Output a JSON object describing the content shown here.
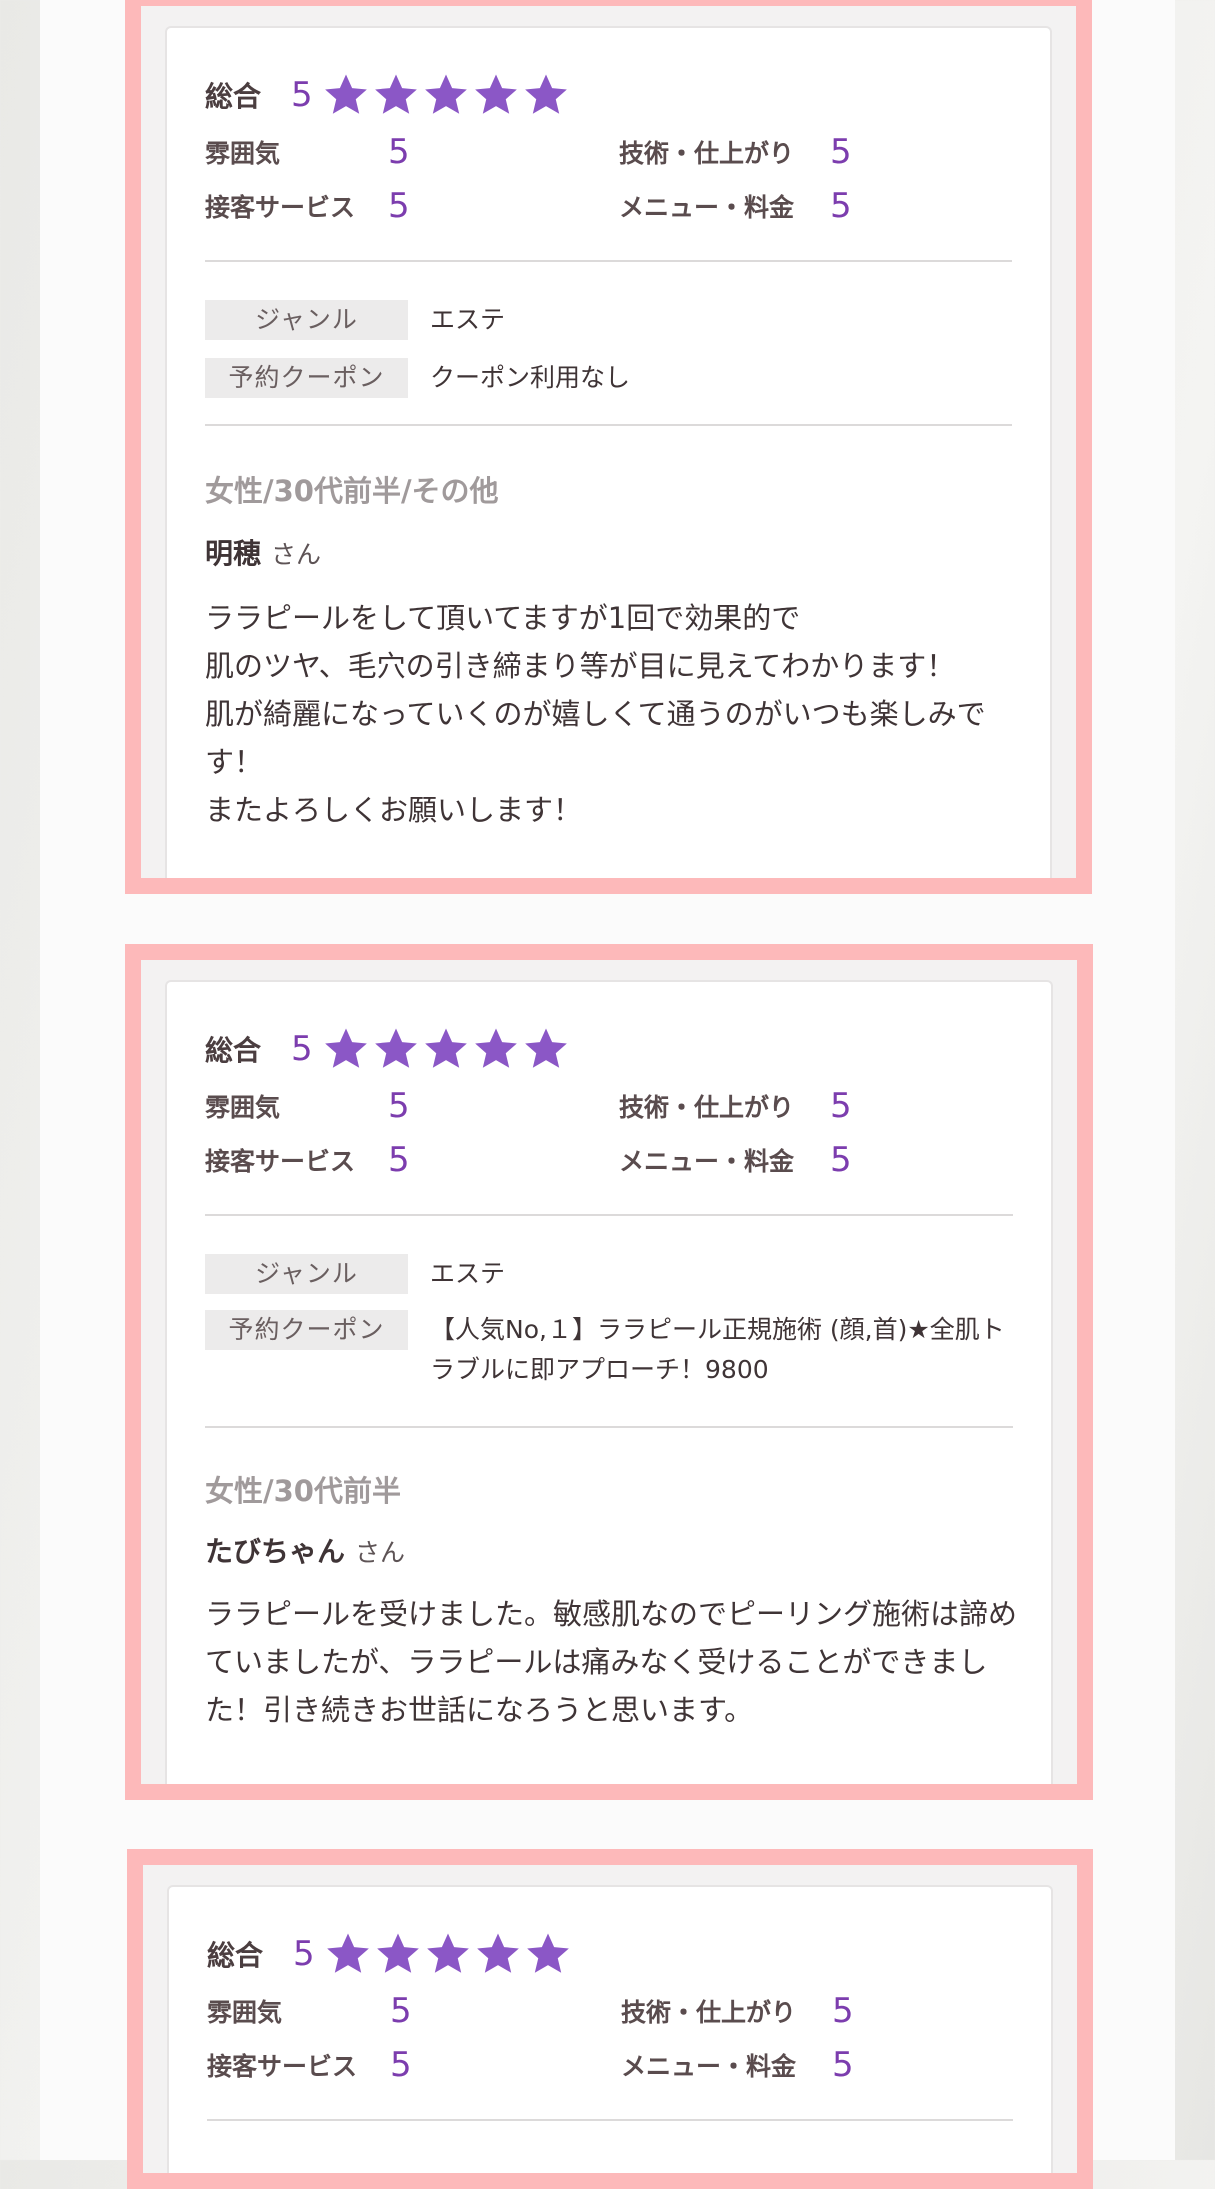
{
  "colors": {
    "frame_border": "#fdb9ba",
    "star": "#8b57c6",
    "score": "#7c3dae"
  },
  "icons": {
    "star": "star-icon"
  },
  "reviews": [
    {
      "overall_label": "総合",
      "overall_score": "5",
      "stars": 5,
      "ratings": [
        {
          "label": "雰囲気",
          "value": "5"
        },
        {
          "label": "技術・仕上がり",
          "value": "5"
        },
        {
          "label": "接客サービス",
          "value": "5"
        },
        {
          "label": "メニュー・料金",
          "value": "5"
        }
      ],
      "genre_label": "ジャンル",
      "genre_value": "エステ",
      "coupon_label": "予約クーポン",
      "coupon_value": "クーポン利用なし",
      "reviewer_meta": "女性/30代前半/その他",
      "reviewer_name": "明穂",
      "honorific": "さん",
      "text": "ララピールをして頂いてますが1回で効果的で\n肌のツヤ、毛穴の引き締まり等が目に見えてわかります！\n肌が綺麗になっていくのが嬉しくて通うのがいつも楽しみです！\nまたよろしくお願いします！"
    },
    {
      "overall_label": "総合",
      "overall_score": "5",
      "stars": 5,
      "ratings": [
        {
          "label": "雰囲気",
          "value": "5"
        },
        {
          "label": "技術・仕上がり",
          "value": "5"
        },
        {
          "label": "接客サービス",
          "value": "5"
        },
        {
          "label": "メニュー・料金",
          "value": "5"
        }
      ],
      "genre_label": "ジャンル",
      "genre_value": "エステ",
      "coupon_label": "予約クーポン",
      "coupon_value": "【人気No,１】ララピール正規施術 (顔,首)★全肌トラブルに即アプローチ！9800",
      "reviewer_meta": "女性/30代前半",
      "reviewer_name": "たびちゃん",
      "honorific": "さん",
      "text": "ララピールを受けました。敏感肌なのでピーリング施術は諦めていましたが、ララピールは痛みなく受けることができました！引き続きお世話になろうと思います。"
    },
    {
      "overall_label": "総合",
      "overall_score": "5",
      "stars": 5,
      "ratings": [
        {
          "label": "雰囲気",
          "value": "5"
        },
        {
          "label": "技術・仕上がり",
          "value": "5"
        },
        {
          "label": "接客サービス",
          "value": "5"
        },
        {
          "label": "メニュー・料金",
          "value": "5"
        }
      ]
    }
  ]
}
